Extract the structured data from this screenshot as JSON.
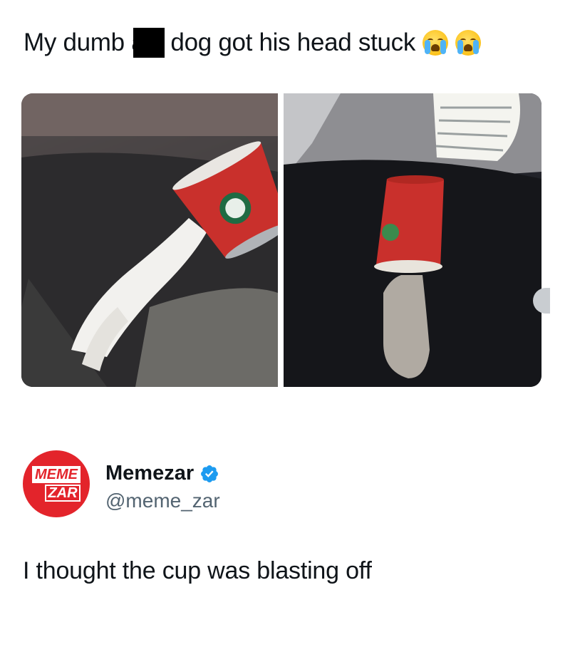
{
  "post": {
    "text_before": "My dumb a",
    "text_after": "dog got his head stuck",
    "emojis": [
      "loudly-crying-face-emoji",
      "loudly-crying-face-emoji"
    ]
  },
  "media": {
    "photos": [
      "photo-dog-with-starbucks-cup-1",
      "photo-dog-with-starbucks-cup-2"
    ]
  },
  "author": {
    "display_name": "Memezar",
    "handle": "@meme_zar",
    "avatar_line1": "MEME",
    "avatar_line2": "ZAR",
    "verified": true
  },
  "reply": {
    "text": "I thought the cup was blasting off"
  },
  "colors": {
    "verified": "#1d9bf0",
    "avatar_red": "#e3242b",
    "handle_gray": "#536471",
    "cup_red": "#c9302c"
  }
}
